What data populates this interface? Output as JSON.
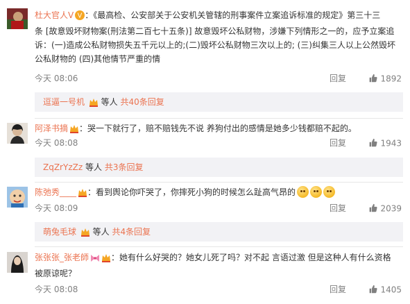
{
  "comments": [
    {
      "user": "杜大官人V",
      "text_lines": [
        "：《最高检、公安部关于公安机关管辖的刑事案件立案追诉标准的规定》第三十三",
        "条 [故意毁坏财物案(刑法第二百七十五条)] 故意毁坏公私财物，涉嫌下列情形之一的，应予立案追",
        "诉：(一)造成公私财物损失五千元以上的;(二)毁坏公私财物三次以上的; (三)纠集三人以上公然毁坏",
        "公私财物的 (四)其他情节严重的情"
      ],
      "time": "今天 08:06",
      "reply": "回复",
      "likes": "1892",
      "sub_user": "逗逼一号机",
      "sub_mid": "等人",
      "sub_count": "共40条回复"
    },
    {
      "user": "阿泽书摘",
      "text_lines": [
        "：哭一下就行了，赔不赔钱先不说 养狗付出的感情是她多少钱都赔不起的。"
      ],
      "time": "今天 08:08",
      "reply": "回复",
      "likes": "1943",
      "sub_user": "ZqZrYzZz",
      "sub_mid": "等人",
      "sub_count": "共3条回复"
    },
    {
      "user": "陈弛秀____",
      "text_lines": [
        "：看到舆论你吓哭了，你摔死小狗的时候怎么趾高气昂的"
      ],
      "time": "今天 08:09",
      "reply": "回复",
      "likes": "2039",
      "sub_user": "萌兔毛球",
      "sub_mid": "等人",
      "sub_count": "共4条回复"
    },
    {
      "user": "张张张_张老師",
      "text_lines": [
        "：她有什么好哭的？她女儿死了吗？对不起 言语过激 但是这种人有什么资格",
        "被原谅呢？"
      ],
      "time": "今天 08:08",
      "reply": "回复",
      "likes": "1405"
    }
  ],
  "colors": {
    "link": "#eb7350",
    "meta": "#808080",
    "sub_bg": "#f2f2f5"
  },
  "icons": {
    "like": "thumb-up-icon",
    "vip": "vip-badge-icon",
    "member": "member-crown-icon"
  }
}
